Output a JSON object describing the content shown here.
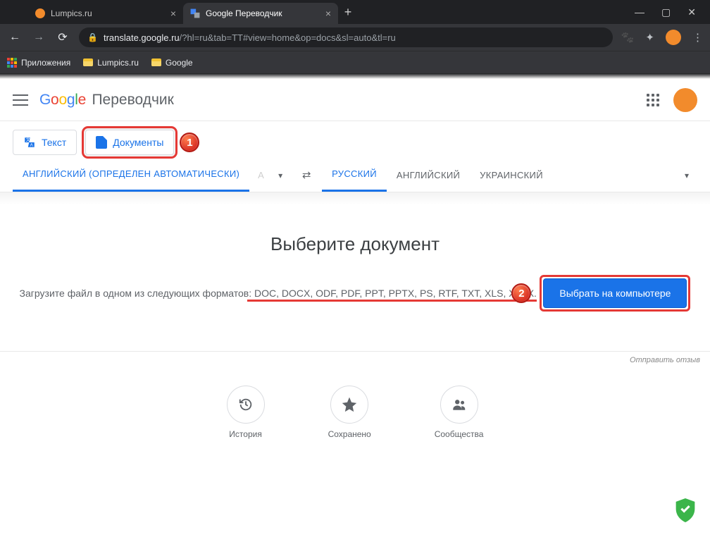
{
  "browser": {
    "tabs": [
      {
        "title": "Lumpics.ru",
        "active": false
      },
      {
        "title": "Google Переводчик",
        "active": true
      }
    ],
    "url_host": "translate.google.ru",
    "url_path": "/?hl=ru&tab=TT#view=home&op=docs&sl=auto&tl=ru",
    "bookmarks": {
      "apps": "Приложения",
      "items": [
        "Lumpics.ru",
        "Google"
      ]
    }
  },
  "header": {
    "logo_suffix": "Переводчик"
  },
  "modes": {
    "text": "Текст",
    "documents": "Документы"
  },
  "step_labels": {
    "one": "1",
    "two": "2"
  },
  "languages": {
    "source": {
      "detected": "АНГЛИЙСКИЙ (ОПРЕДЕЛЕН АВТОМАТИЧЕСКИ)",
      "faded": "А"
    },
    "target": {
      "selected": "РУССКИЙ",
      "options": [
        "АНГЛИЙСКИЙ",
        "УКРАИНСКИЙ"
      ]
    }
  },
  "doc": {
    "title": "Выберите документ",
    "subtitle_prefix": "Загрузите файл в одном из следующих форматов: ",
    "formats": "DOC, DOCX, ODF, PDF, PPT, PPTX, PS, RTF, TXT, XLS, XLSX.",
    "upload_label": "Выбрать на компьютере"
  },
  "feedback": "Отправить отзыв",
  "footer": {
    "history": "История",
    "saved": "Сохранено",
    "community": "Сообщества"
  }
}
